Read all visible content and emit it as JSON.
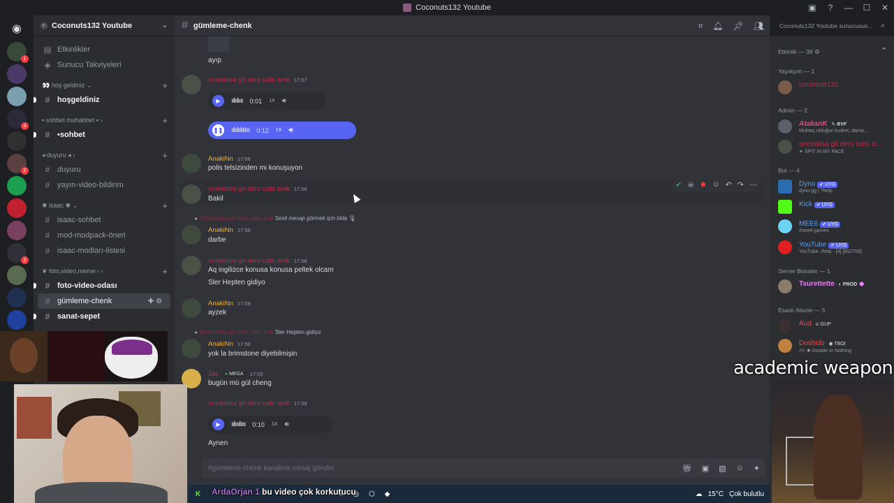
{
  "window": {
    "title": "Coconuts132 Youtube"
  },
  "server": {
    "name": "Coconuts132 Youtube"
  },
  "server_list": [
    {
      "color": "#3a4a3a",
      "badge": "1"
    },
    {
      "color": "#4a3a6a",
      "badge": ""
    },
    {
      "color": "#7aa0b0",
      "badge": ""
    },
    {
      "color": "#2a2a3a",
      "badge": "3"
    },
    {
      "color": "#303030",
      "badge": ""
    },
    {
      "color": "#5a4040",
      "badge": "2"
    },
    {
      "color": "#1aa050",
      "badge": ""
    },
    {
      "color": "#c02030",
      "badge": ""
    },
    {
      "color": "#7a4060",
      "badge": ""
    },
    {
      "color": "#303038",
      "badge": "2"
    },
    {
      "color": "#5a6a50",
      "badge": ""
    },
    {
      "color": "#203050",
      "badge": ""
    },
    {
      "color": "#2040a0",
      "badge": ""
    }
  ],
  "sidebar": {
    "top_items": [
      {
        "label": "Etkinlikler",
        "icon": "calendar-icon"
      },
      {
        "label": "Sunucu Takviyeleri",
        "icon": "boost-icon"
      }
    ],
    "cat_hos": "hoş geldiniz",
    "ch_hosgeldiniz": "hoşgeldiniz",
    "cat_sohbet": "sohbet muhabbet",
    "ch_sohbet": "sohbet",
    "cat_duyuru": "duyuru",
    "ch_duyuru": "duyuru",
    "ch_yayin": "yayın-video-bildirim",
    "cat_isaac": "isaac",
    "ch_isaac_sohbet": "isaac-sohbet",
    "ch_mod": "mod-modpack-öneri",
    "ch_isaac_mod": "isaac-modları-listesi",
    "cat_foto": "foto,video,meme",
    "ch_foto": "foto-video-odası",
    "ch_gumleme": "gümleme-chenk",
    "ch_sanat": "sanat-sepet"
  },
  "chat": {
    "channel": "gümleme-chenk",
    "composer_placeholder": "#gümleme-chenk kanalına mesaj gönder",
    "msg0_text": "ayıp",
    "msg1_name": "onedalisa git ders calis amk",
    "msg1_time": "17:57",
    "voice1_time": "0:01",
    "voice1_speed": "1X",
    "voice2_time": "0:12",
    "voice2_speed": "1X",
    "msg2_name": "AnakiNn",
    "msg2_time": "17:58",
    "msg2_text": "polis telsizinden mi konuşuyon",
    "msg3_name": "onedalisa git ders calis amk",
    "msg3_time": "17:58",
    "msg3_text": "Bakil",
    "msg4_reply_name": "@onedalisa git ders calis amk",
    "msg4_reply_text": "Sesli mesajı görmek için tıkla",
    "msg4_name": "AnakiNn",
    "msg4_time": "17:58",
    "msg4_text": "darbe",
    "msg5_name": "onedalisa git ders calis amk",
    "msg5_time": "17:58",
    "msg5_text1": "Aq ingilizce konusa konusa peltek olcam",
    "msg5_text2": "Sler Hepten gidiyo",
    "msg6_name": "AnakiNn",
    "msg6_time": "17:59",
    "msg6_text": "ayzek",
    "msg7_reply_name": "@onedalisa git ders calis amk",
    "msg7_reply_text": "Sler Hepten gidiyo",
    "msg7_name": "AnakiNn",
    "msg7_time": "17:59",
    "msg7_text": "yok la brimstone diyebilmişin",
    "msg8_name": "Jax",
    "msg8_tag": "MEGA",
    "msg8_time": "17:59",
    "msg8_text": "bugün mü gül cheng",
    "msg9_name": "onedalisa git ders calis amk",
    "msg9_time": "17:59",
    "voice3_time": "0:10",
    "voice3_speed": "1X",
    "msg9_text": "Aynen"
  },
  "search": {
    "placeholder": "Coconuts132 Youtube sunucusun..."
  },
  "members": {
    "events": "Etkinlik — 38",
    "sec_yayincim": "Yayıkçım — 1",
    "coconuts": "coconuts132",
    "sec_admin": "Admin — 2",
    "admin1": "AtakanK",
    "admin1_tag": "RYF",
    "admin1_sub": "Muhtaç olduğun kudret, dama...",
    "admin2": "onedalisa git ders calis a...",
    "admin2_sub": "SPIT IN MY FACE",
    "sec_bot": "Bot — 4",
    "bot1": "Dyno",
    "bot1_sub": "dyno.gg | ?help",
    "bot2": "Kick",
    "bot3": "MEE6",
    "bot3_sub": "/mee6-games",
    "bot4": "YouTube",
    "bot4_sub": "YouTube. /help - [4] [652759]",
    "app_badge": "UYG",
    "sec_booster": "Server Booster — 1",
    "booster1": "Tsurettette",
    "booster1_tag": "PROD",
    "sec_esasli": "Esaslı Abone — 5",
    "esasli1": "Aud",
    "esasli1_tag": "GUP",
    "esasli2": "Doshido",
    "esasli2_tag": "TBOI",
    "esasli2_sub": "Double or Nothing"
  },
  "overlay": {
    "caption": "academic weapon",
    "ticker_name": "ArdaOrjan 1",
    "ticker_text": " bu video çok korkutucu"
  },
  "taskbar": {
    "temp": "15°C",
    "weather": "Çok bulutlu"
  }
}
